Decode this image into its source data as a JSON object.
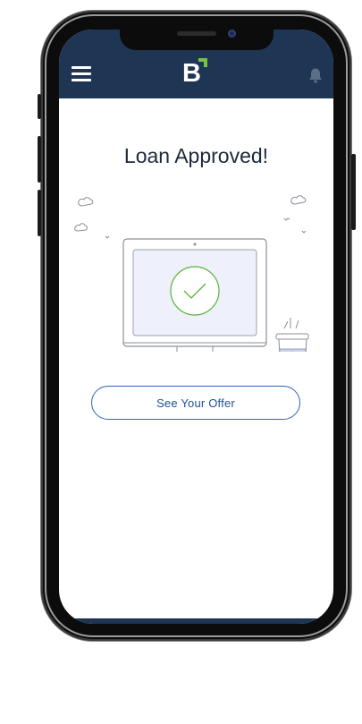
{
  "header": {
    "logo_letter": "B",
    "menu_icon": "hamburger-menu-icon",
    "notification_icon": "bell-icon"
  },
  "main": {
    "title": "Loan Approved!",
    "illustration_icon": "approved-checkmark-computer-illustration",
    "cta_label": "See Your Offer"
  },
  "colors": {
    "header_bg": "#1e3553",
    "logo_accent": "#7cc242",
    "check": "#59b33b",
    "cta_border": "#2c66b8",
    "cta_text": "#1f4f9a"
  }
}
